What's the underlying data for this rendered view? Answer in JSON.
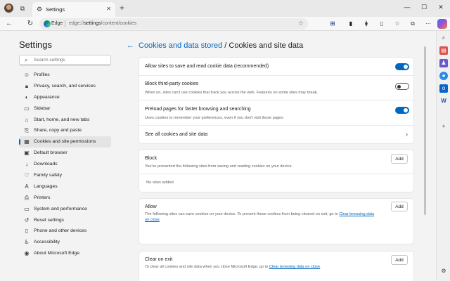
{
  "window": {
    "tab_title": "Settings",
    "new_tab": "+",
    "minimize": "—",
    "maximize": "☐",
    "close": "✕"
  },
  "address_bar": {
    "brand": "Edge",
    "url_prefix": "edge://",
    "url_host": "settings",
    "url_path": "/content/cookies"
  },
  "sidebar": {
    "title": "Settings",
    "search_placeholder": "Search settings",
    "items": [
      {
        "label": "Profiles",
        "icon": "person-icon",
        "active": false
      },
      {
        "label": "Privacy, search, and services",
        "icon": "lock-icon",
        "active": false
      },
      {
        "label": "Appearance",
        "icon": "palette-icon",
        "active": false
      },
      {
        "label": "Sidebar",
        "icon": "sidebar-icon",
        "active": false
      },
      {
        "label": "Start, home, and new tabs",
        "icon": "home-icon",
        "active": false
      },
      {
        "label": "Share, copy and paste",
        "icon": "share-icon",
        "active": false
      },
      {
        "label": "Cookies and site permissions",
        "icon": "cookie-icon",
        "active": true
      },
      {
        "label": "Default browser",
        "icon": "browser-icon",
        "active": false
      },
      {
        "label": "Downloads",
        "icon": "download-icon",
        "active": false
      },
      {
        "label": "Family safety",
        "icon": "family-icon",
        "active": false
      },
      {
        "label": "Languages",
        "icon": "language-icon",
        "active": false
      },
      {
        "label": "Printers",
        "icon": "printer-icon",
        "active": false
      },
      {
        "label": "System and performance",
        "icon": "system-icon",
        "active": false
      },
      {
        "label": "Reset settings",
        "icon": "reset-icon",
        "active": false
      },
      {
        "label": "Phone and other devices",
        "icon": "phone-icon",
        "active": false
      },
      {
        "label": "Accessibility",
        "icon": "accessibility-icon",
        "active": false
      },
      {
        "label": "About Microsoft Edge",
        "icon": "edge-icon",
        "active": false
      }
    ]
  },
  "main": {
    "breadcrumb_parent": "Cookies and data stored",
    "breadcrumb_sep": " / ",
    "breadcrumb_current": "Cookies and site data",
    "settings": [
      {
        "title": "Allow sites to save and read cookie data (recommended)",
        "desc": "",
        "toggle": "on"
      },
      {
        "title": "Block third-party cookies",
        "desc": "When on, sites can't use cookies that track you across the web. Features on some sites may break.",
        "toggle": "off"
      },
      {
        "title": "Preload pages for faster browsing and searching",
        "desc": "Uses cookies to remember your preferences, even if you don't visit those pages",
        "toggle": "on"
      },
      {
        "title": "See all cookies and site data",
        "desc": "",
        "toggle": "chevron"
      }
    ],
    "block": {
      "title": "Block",
      "desc": "You've prevented the following sites from saving and reading cookies on your device.",
      "add": "Add",
      "empty": "No sites added"
    },
    "allow": {
      "title": "Allow",
      "desc": "The following sites can save cookies on your device. To prevent these cookies from being cleared on exit, go to ",
      "link1": "Clear browsing data",
      "link2": "on close",
      "end": ".",
      "add": "Add"
    },
    "clear": {
      "title": "Clear on exit",
      "desc": "To clear all cookies and site data when you close Microsoft Edge, go to ",
      "link": "Clear browsing data on close",
      "end": ".",
      "add": "Add"
    }
  },
  "colors": {
    "accent": "#0067c0",
    "background": "#f3f3f3"
  }
}
